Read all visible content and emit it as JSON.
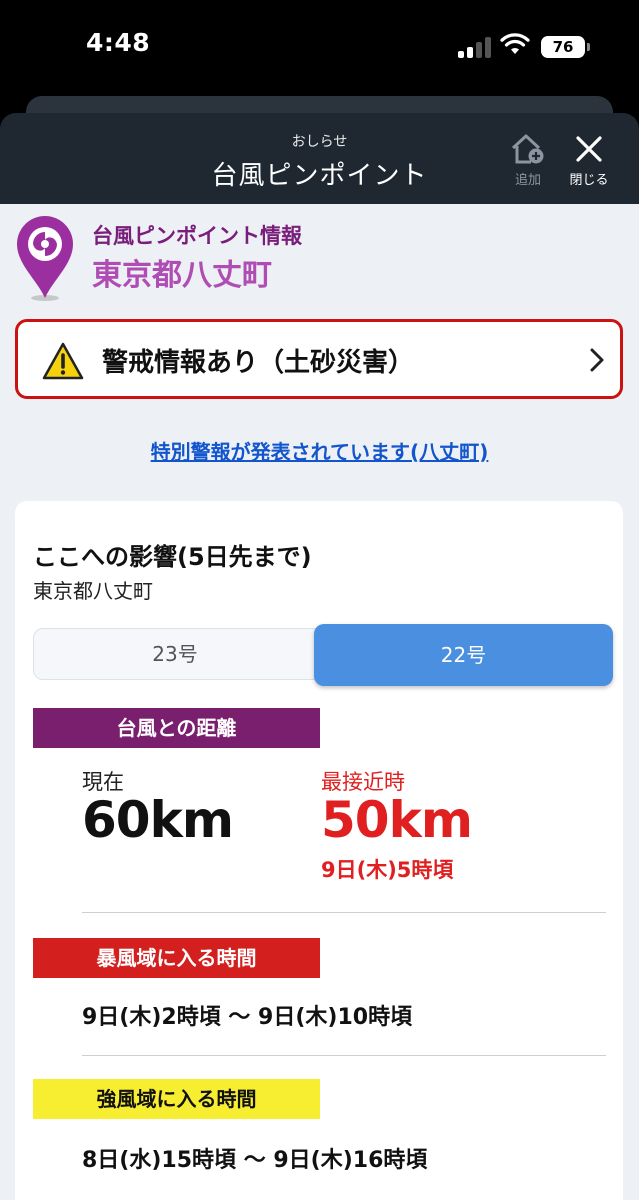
{
  "status_bar": {
    "time": "4:48",
    "battery": "76"
  },
  "header": {
    "subtitle": "おしらせ",
    "title": "台風ピンポイント",
    "add_label": "追加",
    "close_label": "閉じる"
  },
  "location": {
    "label": "台風ピンポイント情報",
    "name": "東京都八丈町"
  },
  "alert": {
    "text": "警戒情報あり（土砂災害）"
  },
  "special_warning_link": "特別警報が発表されています(八丈町)",
  "impact": {
    "title": "ここへの影響(5日先まで)",
    "location": "東京都八丈町",
    "tabs": [
      {
        "label": "23号"
      },
      {
        "label": "22号",
        "selected": true
      }
    ],
    "distance": {
      "label": "台風との距離",
      "now_label": "現在",
      "now_value": "60km",
      "nearest_label": "最接近時",
      "nearest_value": "50km",
      "nearest_time": "9日(木)5時頃"
    },
    "storm_zone": {
      "label": "暴風域に入る時間",
      "time": "9日(木)2時頃 〜 9日(木)10時頃"
    },
    "strong_wind_zone": {
      "label": "強風域に入る時間",
      "time": "8日(水)15時頃 〜 9日(木)16時頃"
    }
  },
  "colors": {
    "header_bg": "#1f2831",
    "alert_border": "#cc1111",
    "link": "#1255cc",
    "selected_tab": "#4a8fe0",
    "distance_label_bg": "#7a1e6e",
    "storm_label_bg": "#d41f1f",
    "strong_label_bg": "#f7ee32",
    "nearest_red": "#e02020",
    "pin_purple": "#9b2fa0"
  }
}
